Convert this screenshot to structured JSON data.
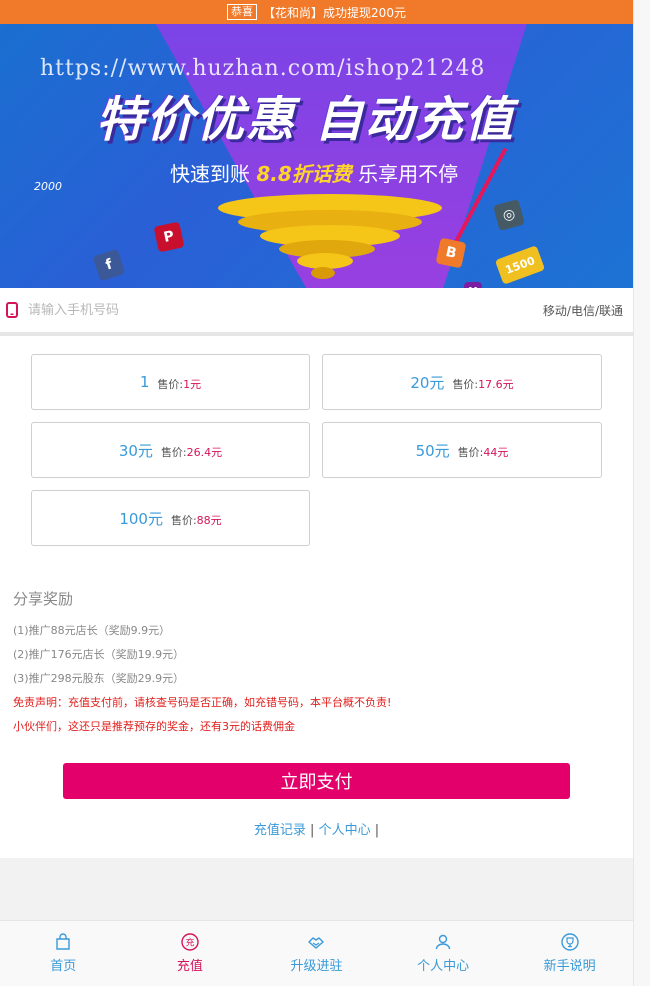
{
  "ticker": {
    "tag": "恭喜",
    "text": "【花和尚】成功提现200元"
  },
  "banner": {
    "watermark": "https://www.huzhan.com/ishop21248",
    "headline": "特价优惠  自动充值",
    "sub_before": "快速到账",
    "sub_highlight": "8.8折话费",
    "sub_after": "乐享用不停",
    "badge_1500": "1500",
    "badge_2000": "2000"
  },
  "phone": {
    "placeholder": "请输入手机号码",
    "carriers": "移动/电信/联通"
  },
  "products": [
    {
      "amount": "1",
      "price_label": "售价:",
      "price": "1元"
    },
    {
      "amount": "20元",
      "price_label": "售价:",
      "price": "17.6元"
    },
    {
      "amount": "30元",
      "price_label": "售价:",
      "price": "26.4元"
    },
    {
      "amount": "50元",
      "price_label": "售价:",
      "price": "44元"
    },
    {
      "amount": "100元",
      "price_label": "售价:",
      "price": "88元"
    }
  ],
  "rewards": {
    "title": "分享奖励",
    "lines": [
      "(1)推广88元店长（奖励9.9元）",
      "(2)推广176元店长（奖励19.9元）",
      "(3)推广298元股东（奖励29.9元）"
    ],
    "disclaimer": "免责声明：充值支付前，请核查号码是否正确，如充错号码，本平台概不负责!",
    "note": "小伙伴们，这还只是推荐预存的奖金，还有3元的话费佣金"
  },
  "pay_button": "立即支付",
  "links": {
    "recharge_records": "充值记录",
    "personal_center": "个人中心",
    "sep": "|"
  },
  "tabs": [
    {
      "label": "首页"
    },
    {
      "label": "充值",
      "icon_text": "充"
    },
    {
      "label": "升级进驻"
    },
    {
      "label": "个人中心"
    },
    {
      "label": "新手说明"
    }
  ],
  "colors": {
    "ticker": "#f07a2a",
    "accent": "#e3006b",
    "link": "#3a9ad9",
    "price": "#d4145a"
  }
}
